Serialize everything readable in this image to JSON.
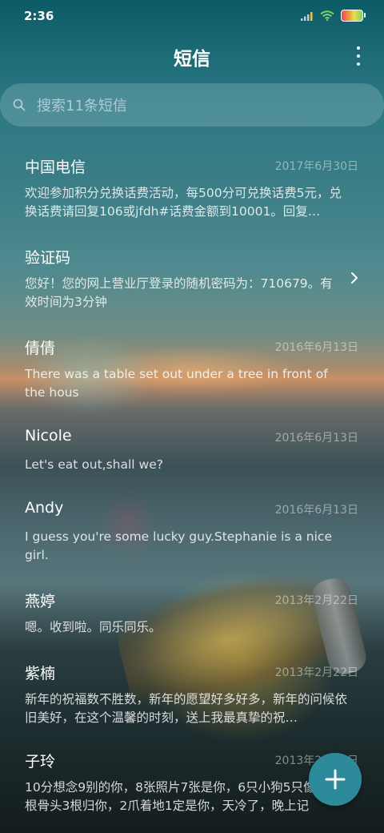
{
  "status_bar": {
    "time": "2:36",
    "icons": [
      "signal-icon",
      "wifi-icon",
      "battery-icon"
    ]
  },
  "header": {
    "title": "短信",
    "menu_icon": "more-vertical-icon"
  },
  "search": {
    "placeholder": "搜索11条短信",
    "icon": "search-icon"
  },
  "messages": [
    {
      "name": "中国电信",
      "date": "2017年6月30日",
      "preview": "欢迎参加积分兑换话费活动，每500分可兑换话费5元，兑换话费请回复106或jfdh#话费金额到10001。回复…"
    },
    {
      "name": "验证码",
      "date": "",
      "preview": "您好！您的网上营业厅登录的随机密码为：710679。有效时间为3分钟"
    },
    {
      "name": "倩倩",
      "date": "2016年6月13日",
      "preview": "There was a table set out under a tree in front of the hous"
    },
    {
      "name": "Nicole",
      "date": "2016年6月13日",
      "preview": "Let's eat out,shall we?"
    },
    {
      "name": "Andy",
      "date": "2016年6月13日",
      "preview": "I guess you're some lucky guy.Stephanie is a nice girl."
    },
    {
      "name": "燕婷",
      "date": "2013年2月22日",
      "preview": "嗯。收到啦。同乐同乐。"
    },
    {
      "name": "紫楠",
      "date": "2013年2月22日",
      "preview": "新年的祝福数不胜数，新年的愿望好多好多，新年的问候依旧美好，在这个温馨的时刻，送上我最真挚的祝…"
    },
    {
      "name": "子玲",
      "date": "2013年2月22日",
      "preview": "10分想念9别的你，8张照片7张是你，6只小狗5只像你，4根骨头3根归你，2爪着地1定是你，天冷了，晚上记"
    }
  ],
  "fab": {
    "icon": "plus-icon"
  },
  "colors": {
    "fab": "#2c8a9a",
    "text": "#ffffff"
  }
}
